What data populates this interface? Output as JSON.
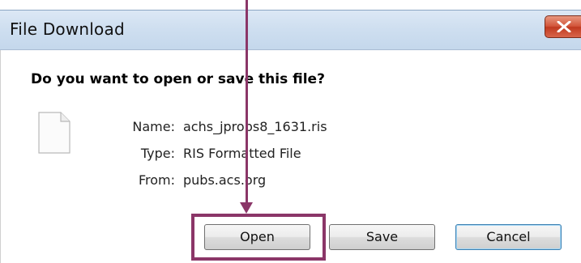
{
  "window": {
    "title": "File Download"
  },
  "dialog": {
    "question": "Do you want to open or save this file?",
    "file": {
      "name_label": "Name:",
      "name_value": "achs_jprobs8_1631.ris",
      "type_label": "Type:",
      "type_value": "RIS Formatted File",
      "from_label": "From:",
      "from_value": "pubs.acs.org"
    },
    "buttons": {
      "open_label": "Open",
      "save_label": "Save",
      "cancel_label": "Cancel"
    }
  },
  "icons": {
    "close": "close-icon",
    "file": "file-icon"
  },
  "colors": {
    "annotation": "#8b3668",
    "close_button": "#c03a20",
    "titlebar": "#cfdff0"
  }
}
